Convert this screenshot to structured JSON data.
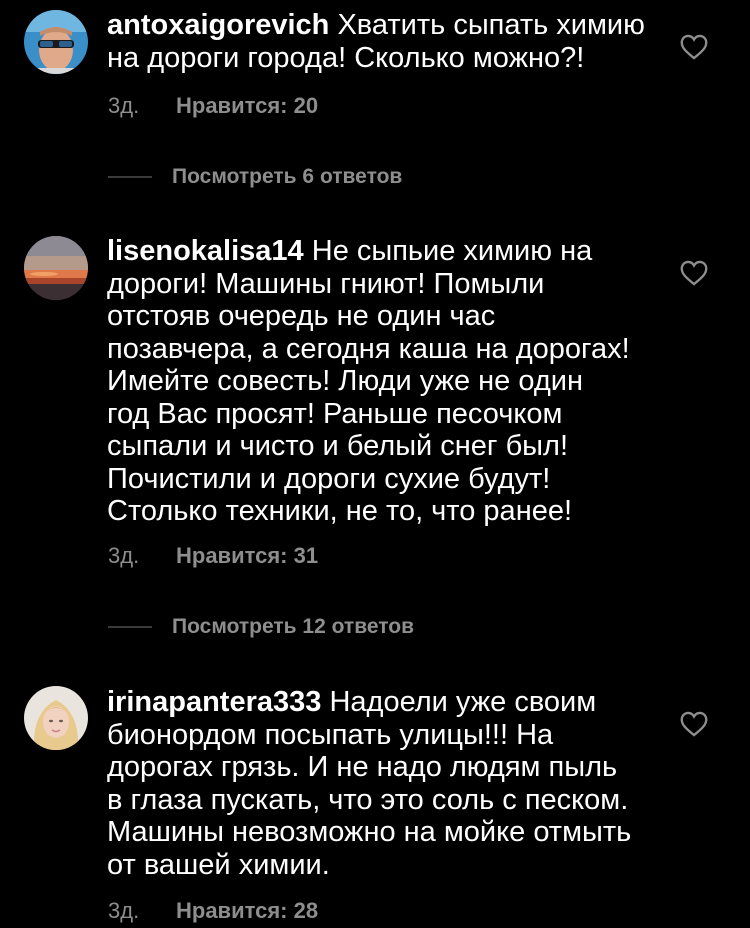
{
  "comments": [
    {
      "username": "antoxaigorevich",
      "text": "Хватить сыпать химию\nна дороги города! Сколько можно?!",
      "time": "3д.",
      "likes": "Нравится: 20",
      "replies": "Посмотреть 6 ответов",
      "avatar_icon": "user-avatar-sunglasses",
      "heart_icon": "heart-outline-icon"
    },
    {
      "username": "lisenokalisa14",
      "text": "Не сыпьие химию на\nдороги! Машины гниют! Помыли\nотстояв очередь не один час\nпозавчера, а сегодня каша на дорогах!\nИмейте совесть! Люди уже не один\nгод Вас просят! Раньше песочком\nсыпали и чисто и белый снег был!\nПочистили и дороги сухие будут!\nСтолько техники, не то, что ранее!",
      "time": "3д.",
      "likes": "Нравится: 31",
      "replies": "Посмотреть 12 ответов",
      "avatar_icon": "user-avatar-sunset",
      "heart_icon": "heart-outline-icon"
    },
    {
      "username": "irinapantera333",
      "text": "Надоели уже своим\nбионордом посыпать улицы!!! На\nдорогах грязь. И не надо людям пыль\nв глаза пускать, что это соль с песком.\nМашины невозможно на мойке отмыть\nот вашей химии.",
      "time": "3д.",
      "likes": "Нравится: 28",
      "avatar_icon": "user-avatar-portrait",
      "heart_icon": "heart-outline-icon"
    }
  ],
  "colors": {
    "background": "#000000",
    "text": "#ffffff",
    "secondary": "#8e8e8e"
  }
}
